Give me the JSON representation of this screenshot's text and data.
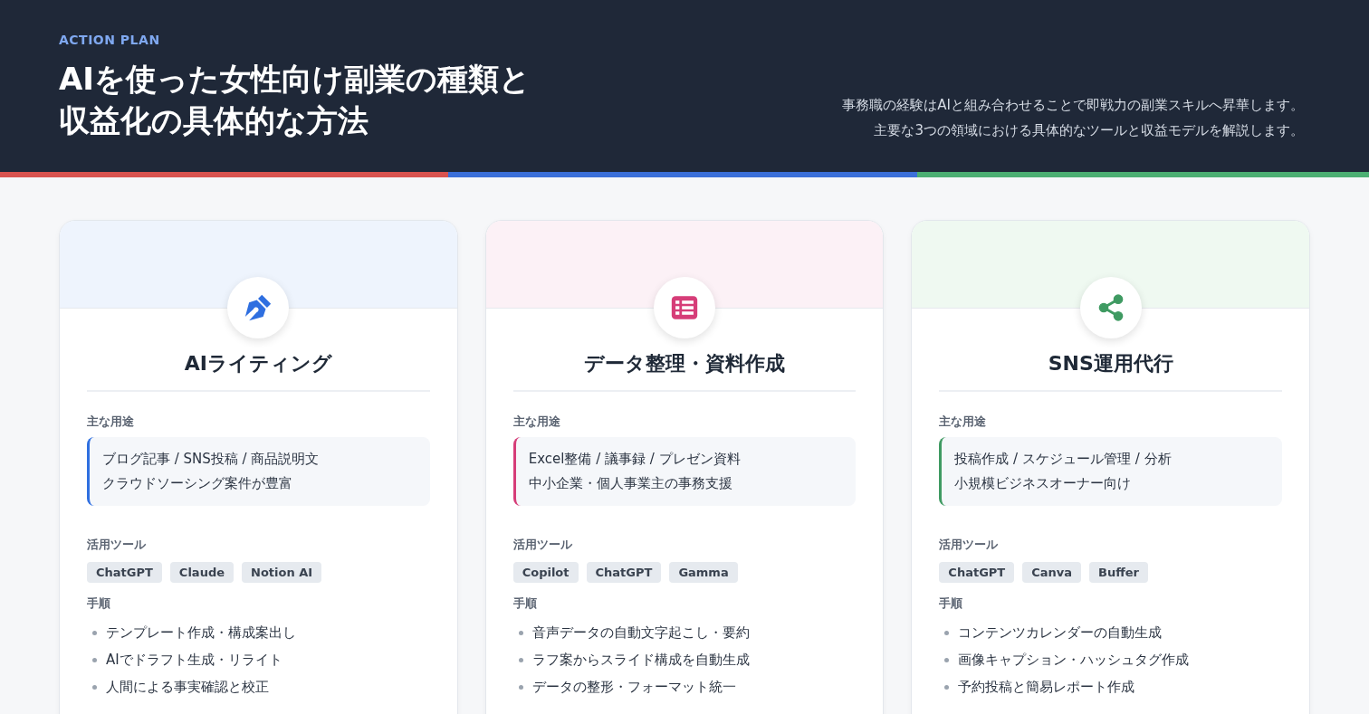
{
  "header": {
    "eyebrow": "ACTION PLAN",
    "title_lines": [
      "AIを使った女性向け副業の種類と",
      "収益化の具体的な方法"
    ],
    "description_lines": [
      "事務職の経験はAIと組み合わせることで即戦力の副業スキルへ昇華します。",
      "主要な3つの領域における具体的なツールと収益モデルを解説します。"
    ]
  },
  "cards": [
    {
      "color": "#2f6fe0",
      "title": "AIライティング",
      "usage_label": "主な用途",
      "usage_lines": [
        "ブログ記事 / SNS投稿 / 商品説明文",
        "クラウドソーシング案件が豊富"
      ],
      "tools_label": "活用ツール",
      "tools": [
        "ChatGPT",
        "Claude",
        "Notion AI"
      ],
      "steps_label": "手順",
      "steps": [
        "テンプレート作成・構成案出し",
        "AIでドラフト生成・リライト",
        "人間による事実確認と校正"
      ]
    },
    {
      "color": "#d63d78",
      "title": "データ整理・資料作成",
      "usage_label": "主な用途",
      "usage_lines": [
        "Excel整備 / 議事録 / プレゼン資料",
        "中小企業・個人事業主の事務支援"
      ],
      "tools_label": "活用ツール",
      "tools": [
        "Copilot",
        "ChatGPT",
        "Gamma"
      ],
      "steps_label": "手順",
      "steps": [
        "音声データの自動文字起こし・要約",
        "ラフ案からスライド構成を自動生成",
        "データの整形・フォーマット統一"
      ]
    },
    {
      "color": "#3f9a62",
      "title": "SNS運用代行",
      "usage_label": "主な用途",
      "usage_lines": [
        "投稿作成 / スケジュール管理 / 分析",
        "小規模ビジネスオーナー向け"
      ],
      "tools_label": "活用ツール",
      "tools": [
        "ChatGPT",
        "Canva",
        "Buffer"
      ],
      "steps_label": "手順",
      "steps": [
        "コンテンツカレンダーの自動生成",
        "画像キャプション・ハッシュタグ作成",
        "予約投稿と簡易レポート作成"
      ]
    }
  ]
}
